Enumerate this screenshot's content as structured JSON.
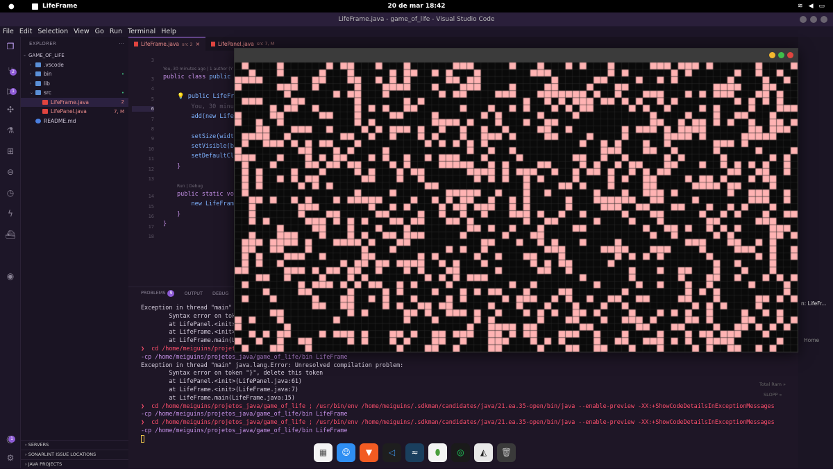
{
  "topbar": {
    "app_name": "LifeFrame",
    "clock": "20 de mar  18:42"
  },
  "window": {
    "title": "LifeFrame.java - game_of_life - Visual Studio Code"
  },
  "menu": [
    "File",
    "Edit",
    "Selection",
    "View",
    "Go",
    "Run",
    "Terminal",
    "Help"
  ],
  "activity_badges": {
    "source_control": "2",
    "run": "1",
    "accounts": "1"
  },
  "explorer": {
    "header": "EXPLORER",
    "more": "···",
    "project": "GAME_OF_LIFE",
    "items": [
      {
        "label": ".vscode",
        "type": "folder",
        "indent": 1,
        "right": ""
      },
      {
        "label": "bin",
        "type": "folder",
        "indent": 1,
        "right": "•"
      },
      {
        "label": "lib",
        "type": "folder",
        "indent": 1,
        "right": ""
      },
      {
        "label": "src",
        "type": "folder-open",
        "indent": 1,
        "right": "•"
      },
      {
        "label": "LifeFrame.java",
        "type": "java",
        "indent": 2,
        "right": "2"
      },
      {
        "label": "LifePanel.java",
        "type": "java",
        "indent": 2,
        "right": "7, M"
      },
      {
        "label": "README.md",
        "type": "info",
        "indent": 1,
        "right": ""
      }
    ],
    "bottom": [
      "SERVERS",
      "SONARLINT ISSUE LOCATIONS",
      "JAVA PROJECTS"
    ]
  },
  "tabs": [
    {
      "label": "LifeFrame.java",
      "meta": "src  2",
      "close": "×"
    },
    {
      "label": "LifePanel.java",
      "meta": "src  7, M",
      "close": ""
    }
  ],
  "code": {
    "line_numbers": [
      "3",
      "",
      "3",
      "4",
      "5",
      "6",
      "7",
      "8",
      "9",
      "10",
      "11",
      "12",
      "13",
      "",
      "14",
      "15",
      "16",
      "17",
      "18"
    ],
    "blame": "You, 30 minutes ago | 1 author (Y",
    "lines": [
      "public class LifeFra",
      "public LifeFrame",
      "    You, 30 minute",
      "    add(new Life",
      "    setSize(widt",
      "    setVisible(b",
      "    setDefaultCl",
      "}",
      "Run | Debug",
      "public static vo",
      "    new LifeFram",
      "}",
      "}"
    ]
  },
  "panel": {
    "tabs": [
      "PROBLEMS",
      "OUTPUT",
      "DEBUG"
    ],
    "problems_count": "9",
    "terminal": [
      "Exception in thread \"main\"",
      "        Syntax error on tok",
      "",
      "        at LifePanel.<init>",
      "        at LifeFrame.<init>",
      "        at LifeFrame.main(L",
      "❯  cd /home/meiguins/projetos_java/game_of_life ; /usr/bin/env /home/meiguins/.sdkman/candidates/java/21.ea.35-open/bin/java --enable-preview -XX:+ShowCodeDetailsInExceptionMessages",
      "-cp /home/meiguins/projetos_java/game_of_life/bin LifeFrame",
      "Exception in thread \"main\" java.lang.Error: Unresolved compilation problem:",
      "        Syntax error on token \"}\", delete this token",
      "",
      "        at LifePanel.<init>(LifePanel.java:61)",
      "        at LifeFrame.<init>(LifeFrame.java:7)",
      "        at LifeFrame.main(LifeFrame.java:15)",
      "❯  cd /home/meiguins/projetos_java/game_of_life ; /usr/bin/env /home/meiguins/.sdkman/candidates/java/21.ea.35-open/bin/java --enable-preview -XX:+ShowCodeDetailsInExceptionMessages",
      "-cp /home/meiguins/projetos_java/game_of_life/bin LifeFrame",
      "❯  cd /home/meiguins/projetos_java/game_of_life ; /usr/bin/env /home/meiguins/.sdkman/candidates/java/21.ea.35-open/bin/java --enable-preview -XX:+ShowCodeDetailsInExceptionMessages",
      "-cp /home/meiguins/projetos_java/game_of_life/bin LifeFrame"
    ]
  },
  "right_panel": {
    "title": "n: LifeFr...",
    "home": "Home",
    "total": "Total Ram »",
    "slot": "SLOPP »"
  },
  "life_grid": {
    "cols": 80,
    "rows": 41,
    "alive_color": "#ffb3b3",
    "dead_color": "#0a0a0a",
    "grid_color": "#2c2c2c"
  },
  "dock": [
    "finder",
    "brave",
    "vscode",
    "mysql",
    "mongodb",
    "spotify",
    "inkscape",
    "trash"
  ]
}
